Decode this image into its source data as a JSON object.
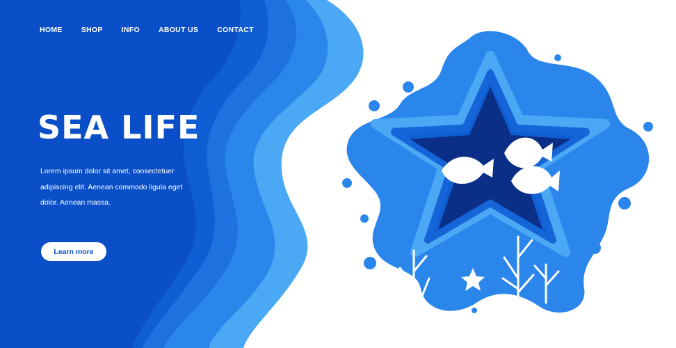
{
  "nav": {
    "items": [
      {
        "label": "HOME"
      },
      {
        "label": "SHOP"
      },
      {
        "label": "INFO"
      },
      {
        "label": "ABOUT US"
      },
      {
        "label": "CONTACT"
      }
    ]
  },
  "hero": {
    "title": "SEA LIFE",
    "description": "Lorem ipsum dolor sit amet, consectetuer adipiscing elit. Aenean commodo ligula eget dolor. Aenean massa.",
    "cta_label": "Learn more"
  },
  "colors": {
    "deep_blue": "#0a4fc7",
    "mid_blue": "#1565d8",
    "light_blue": "#2b86ec",
    "pale_blue": "#4aa8f5",
    "navy": "#0b2f86",
    "white": "#ffffff"
  },
  "illustration": {
    "icons": [
      "starfish-frame",
      "fish-icon",
      "coral-icon",
      "seaweed-icon",
      "bubble-icon",
      "starfish-icon"
    ]
  }
}
